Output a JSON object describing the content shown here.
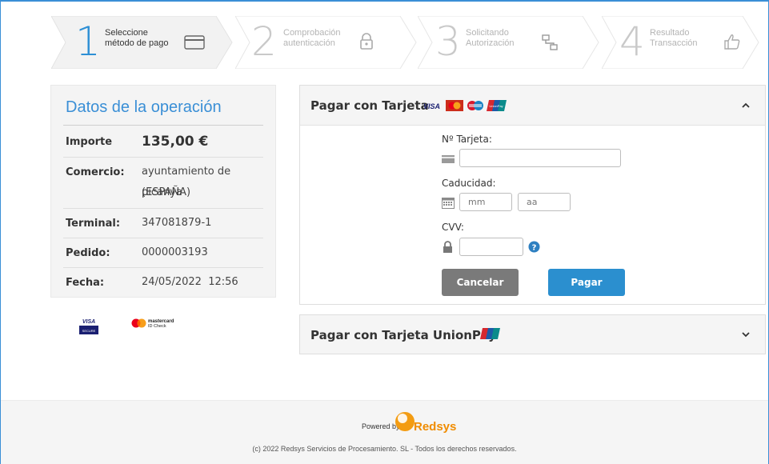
{
  "steps": [
    {
      "number": "1",
      "line1": "Seleccione",
      "line2": "método de pago",
      "icon": "credit-card-icon",
      "active": true
    },
    {
      "number": "2",
      "line1": "Comprobación",
      "line2": "autenticación",
      "icon": "padlock-icon",
      "active": false
    },
    {
      "number": "3",
      "line1": "Solicitando",
      "line2": "Autorización",
      "icon": "network-icon",
      "active": false
    },
    {
      "number": "4",
      "line1": "Resultado",
      "line2": "Transacción",
      "icon": "thumbs-up-icon",
      "active": false
    }
  ],
  "operation": {
    "title": "Datos de la operación",
    "rows": [
      {
        "key": "Importe",
        "value": "135,00 €"
      },
      {
        "key": "Comercio:",
        "value_line1": "ayuntamiento de picanya",
        "value_line2": "(ESPAÑA)"
      },
      {
        "key": "Terminal:",
        "value": "347081879-1"
      },
      {
        "key": "Pedido:",
        "value": "0000003193"
      },
      {
        "key": "Fecha:",
        "value": "24/05/2022  12:56"
      }
    ]
  },
  "badges": {
    "visa_secure_line1": "VISA",
    "visa_secure_line2": "SECURE",
    "mc_line1": "mastercard",
    "mc_line2": "ID Check"
  },
  "card_panel": {
    "title": "Pagar con Tarjeta",
    "logos": [
      "visa",
      "mastercard",
      "maestro",
      "unionpay"
    ],
    "logo_texts": {
      "visa": "VISA",
      "unionpay": "UnionPay"
    },
    "card_number_label": "Nº Tarjeta:",
    "expiry_label": "Caducidad:",
    "month_placeholder": "mm",
    "year_placeholder": "aa",
    "cvv_label": "CVV:",
    "cancel_label": "Cancelar",
    "pay_label": "Pagar"
  },
  "unionpay_panel": {
    "title": "Pagar con Tarjeta UnionPay"
  },
  "footer": {
    "powered_by": "Powered by",
    "brand": "Redsys",
    "copyright": "(c) 2022 Redsys Servicios de Procesamiento. SL - Todos los derechos reservados."
  },
  "colors": {
    "accent_blue": "#2d8fd5",
    "pay_button": "#2b8fcf",
    "cancel_button": "#7a7a7a",
    "redsys_orange": "#f39c12",
    "help_icon": "#2d7fc1"
  }
}
